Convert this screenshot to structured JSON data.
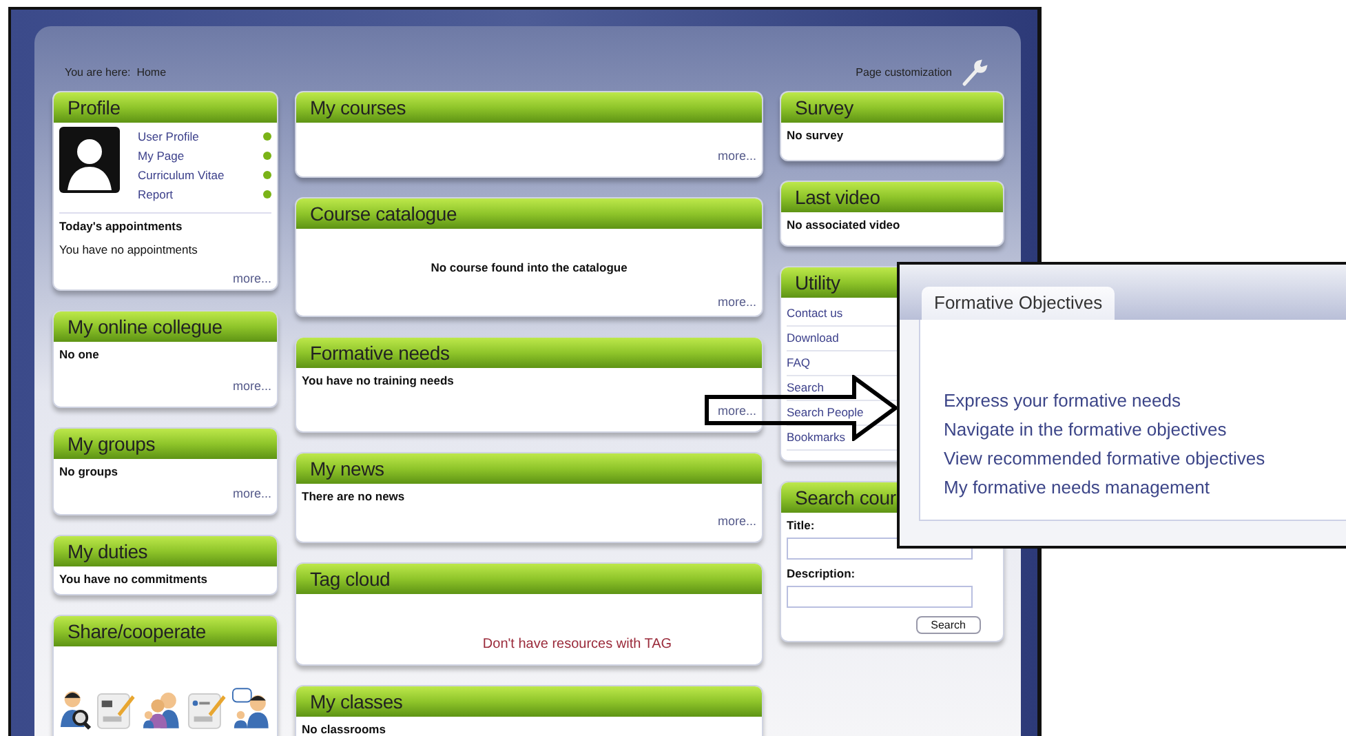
{
  "breadcrumb": "You are here:  Home",
  "page_customization": "Page customization",
  "columns": [
    {
      "panels": [
        {
          "title": "Profile",
          "kind": "profile",
          "links": [
            "User Profile",
            "My Page",
            "Curriculum Vitae",
            "Report"
          ],
          "subtitle": "Today's appointments",
          "text": "You have no appointments",
          "more": "more..."
        },
        {
          "title": "My online collegue",
          "kind": "text",
          "text": "No one",
          "more": "more..."
        },
        {
          "title": "My groups",
          "kind": "text",
          "text": "No groups",
          "more": "more..."
        },
        {
          "title": "My duties",
          "kind": "text",
          "text": "You have no commitments"
        },
        {
          "title": "Share/cooperate",
          "kind": "icons"
        }
      ]
    },
    {
      "panels": [
        {
          "title": "My courses",
          "kind": "text",
          "more": "more..."
        },
        {
          "title": "Course catalogue",
          "kind": "center",
          "text": "No course found into the catalogue",
          "more": "more..."
        },
        {
          "title": "Formative needs",
          "kind": "text",
          "text": "You have no training needs",
          "more": "more..."
        },
        {
          "title": "My news",
          "kind": "text",
          "text": "There are no news",
          "more": "more..."
        },
        {
          "title": "Tag cloud",
          "kind": "alert",
          "text": "Don't have resources with TAG"
        },
        {
          "title": "My classes",
          "kind": "text",
          "text": "No classrooms"
        }
      ]
    },
    {
      "panels": [
        {
          "title": "Survey",
          "kind": "text",
          "text": "No survey"
        },
        {
          "title": "Last video",
          "kind": "text",
          "text": "No associated video"
        },
        {
          "title": "Utility",
          "kind": "list",
          "items": [
            "Contact us",
            "Download",
            "FAQ",
            "Search",
            "Search People",
            "Bookmarks"
          ]
        },
        {
          "title": "Search cour",
          "kind": "form",
          "fields": [
            "Title:",
            "Description:"
          ],
          "button": "Search"
        }
      ]
    }
  ],
  "callout": {
    "tab": "Formative Objectives",
    "links": [
      "Express your formative needs",
      "Navigate in the formative objectives",
      "View recommended formative objectives",
      "My formative needs management"
    ]
  }
}
